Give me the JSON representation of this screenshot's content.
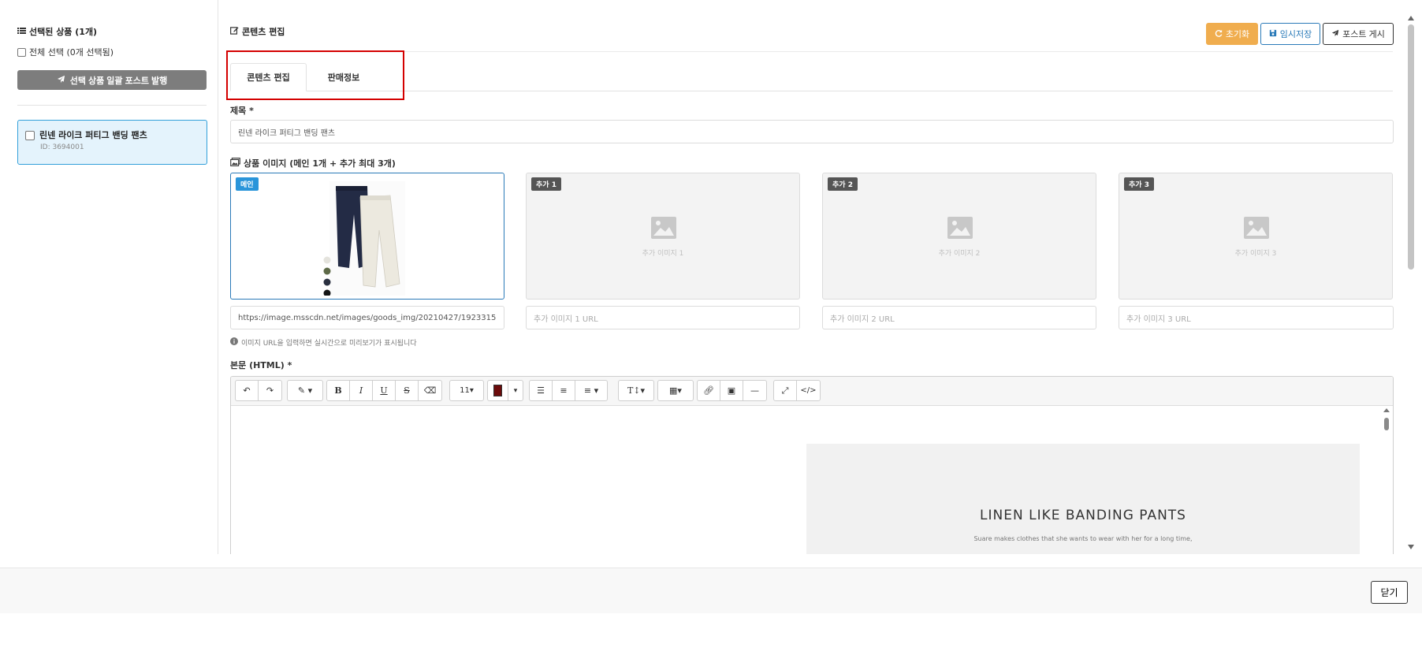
{
  "sidebar": {
    "title": "선택된 상품 (1개)",
    "select_all": "전체 선택 (0개 선택됨)",
    "bulk_button": "선택 상품 일괄 포스트 발행",
    "products": [
      {
        "name": "린넨 라이크 퍼티그 밴딩 팬츠",
        "id": "ID: 3694001"
      }
    ]
  },
  "header": {
    "title": "콘텐츠 편집",
    "reset_label": "초기화",
    "temp_save_label": "임시저장",
    "post_label": "포스트 게시"
  },
  "tabs": [
    {
      "label": "콘텐츠 편집",
      "active": true
    },
    {
      "label": "판매정보",
      "active": false
    }
  ],
  "title_field": {
    "label": "제목 *",
    "value": "린넨 라이크 퍼티그 밴딩 팬츠"
  },
  "images": {
    "label": "상품 이미지 (메인 1개 + 추가 최대 3개)",
    "slots": [
      {
        "badge": "메인",
        "placeholder_text": "",
        "url": "https://image.msscdn.net/images/goods_img/20210427/1923315",
        "url_placeholder": ""
      },
      {
        "badge": "추가 1",
        "placeholder_text": "추가 이미지 1",
        "url": "",
        "url_placeholder": "추가 이미지 1 URL"
      },
      {
        "badge": "추가 2",
        "placeholder_text": "추가 이미지 2",
        "url": "",
        "url_placeholder": "추가 이미지 2 URL"
      },
      {
        "badge": "추가 3",
        "placeholder_text": "추가 이미지 3",
        "url": "",
        "url_placeholder": "추가 이미지 3 URL"
      }
    ],
    "hint": "이미지 URL을 입력하면 실시간으로 미리보기가 표시됩니다"
  },
  "body_field": {
    "label": "본문 (HTML) *",
    "font_size": "11",
    "content_title": "LINEN LIKE BANDING PANTS",
    "content_sub": "Suare makes clothes that she wants to wear with her for a long time,"
  },
  "colors": {
    "accent": "#2a7ab8",
    "reset": "#f0ad4e",
    "highlight": "#d40000",
    "text_color_swatch": "#6b0b0b"
  },
  "footer": {
    "close_label": "닫기"
  }
}
